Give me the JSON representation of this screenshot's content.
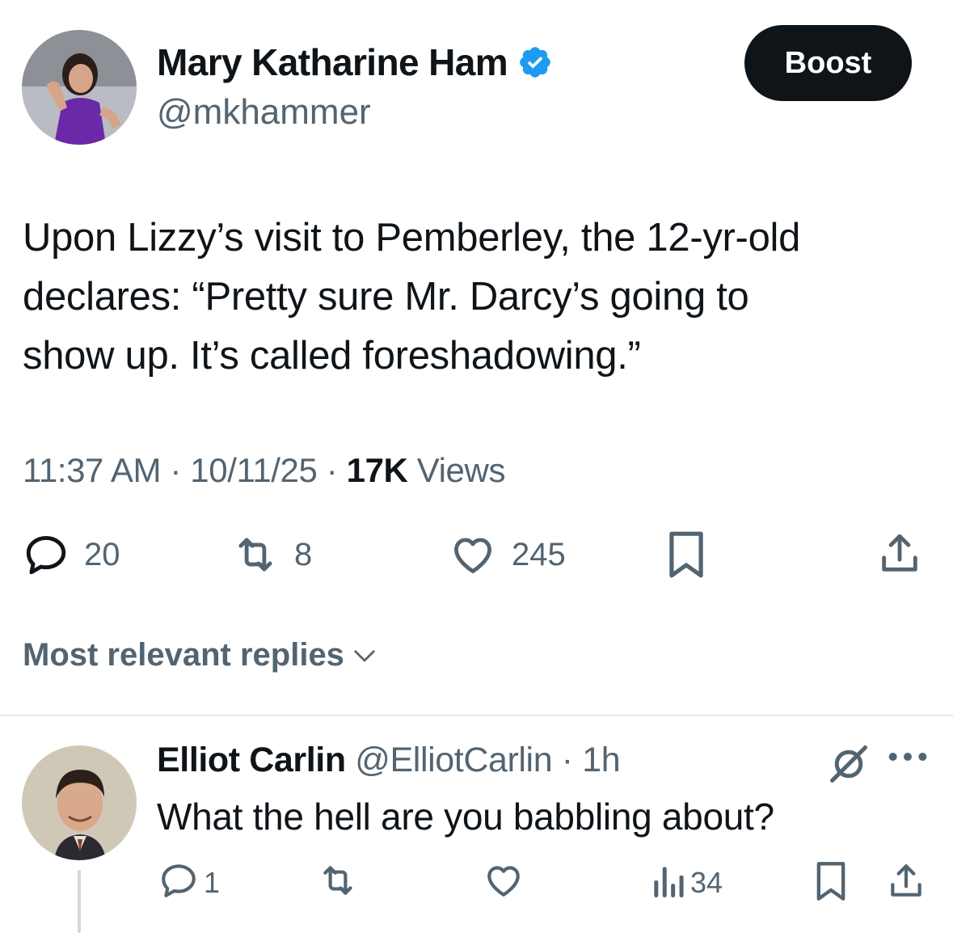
{
  "post": {
    "author_name": "Mary Katharine Ham",
    "author_handle": "@mkhammer",
    "boost_label": "Boost",
    "text_lines": [
      "Upon Lizzy’s visit to Pemberley, the 12-yr-old",
      "declares: “Pretty sure Mr. Darcy’s going to",
      "show up. It’s called foreshadowing.”"
    ],
    "time": "11:37 AM",
    "date": "10/11/25",
    "separator": "·",
    "views_count": "17K",
    "views_label": "Views",
    "replies": "20",
    "reposts": "8",
    "likes": "245",
    "icons": [
      "reply-icon",
      "repost-icon",
      "like-icon",
      "bookmark-icon",
      "share-icon",
      "verified-icon"
    ]
  },
  "replies_section": {
    "sort_label": "Most relevant replies"
  },
  "reply": {
    "author_name": "Elliot Carlin",
    "author_handle": "@ElliotCarlin",
    "time": "1h",
    "separator": "·",
    "text": "What the hell are you babbling about?",
    "replies": "1",
    "views": "34",
    "icons": [
      "grok-icon",
      "more-icon",
      "reply-icon",
      "repost-icon",
      "like-icon",
      "views-icon",
      "bookmark-icon",
      "share-icon"
    ]
  },
  "colors": {
    "text": "#0f1419",
    "secondary": "#536471",
    "verified": "#1d9bf0",
    "divider": "#e7e9ea"
  }
}
